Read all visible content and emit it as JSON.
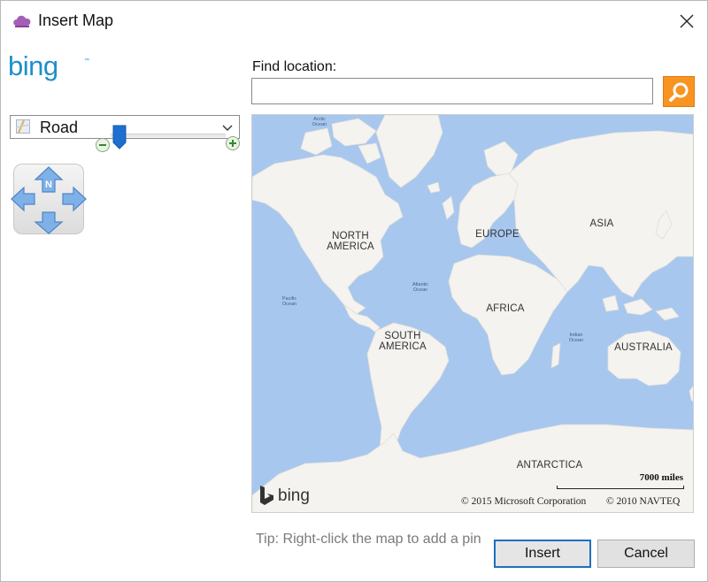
{
  "window": {
    "title": "Insert Map",
    "app_icon": "onenote-cloud-icon",
    "close_icon": "close-icon"
  },
  "left_panel": {
    "logo_text": "bing",
    "view_select": {
      "selected": "Road",
      "icon": "road-map-icon"
    },
    "pan_control": {
      "north_label": "N"
    },
    "zoom": {
      "level_fraction": 0.08,
      "minus_icon": "zoom-out-icon",
      "plus_icon": "zoom-in-icon"
    }
  },
  "search": {
    "label": "Find location:",
    "value": "",
    "placeholder": "",
    "button_icon": "search-icon"
  },
  "map": {
    "continent_labels": {
      "north_america": "NORTH\nAMERICA",
      "south_america": "SOUTH\nAMERICA",
      "europe": "EUROPE",
      "africa": "AFRICA",
      "asia": "ASIA",
      "australia": "AUSTRALIA",
      "antarctica": "ANTARCTICA"
    },
    "ocean_labels": {
      "arctic": "Arctic\nOcean",
      "pacific": "Pacific\nOcean",
      "atlantic": "Atlantic\nOcean",
      "indian": "Indian\nOcean"
    },
    "scale": "7000 miles",
    "logo": "bing",
    "copyright_ms": "© 2015 Microsoft Corporation",
    "copyright_navteq": "© 2010 NAVTEQ"
  },
  "footer": {
    "tip": "Tip: Right-click the map to add a pin",
    "insert_label": "Insert",
    "cancel_label": "Cancel"
  },
  "colors": {
    "water": "#a7c7ee",
    "land": "#f4f3f0",
    "search_button": "#f79422",
    "zoom_thumb": "#1e6fcf",
    "primary_border": "#1f6fbf"
  }
}
